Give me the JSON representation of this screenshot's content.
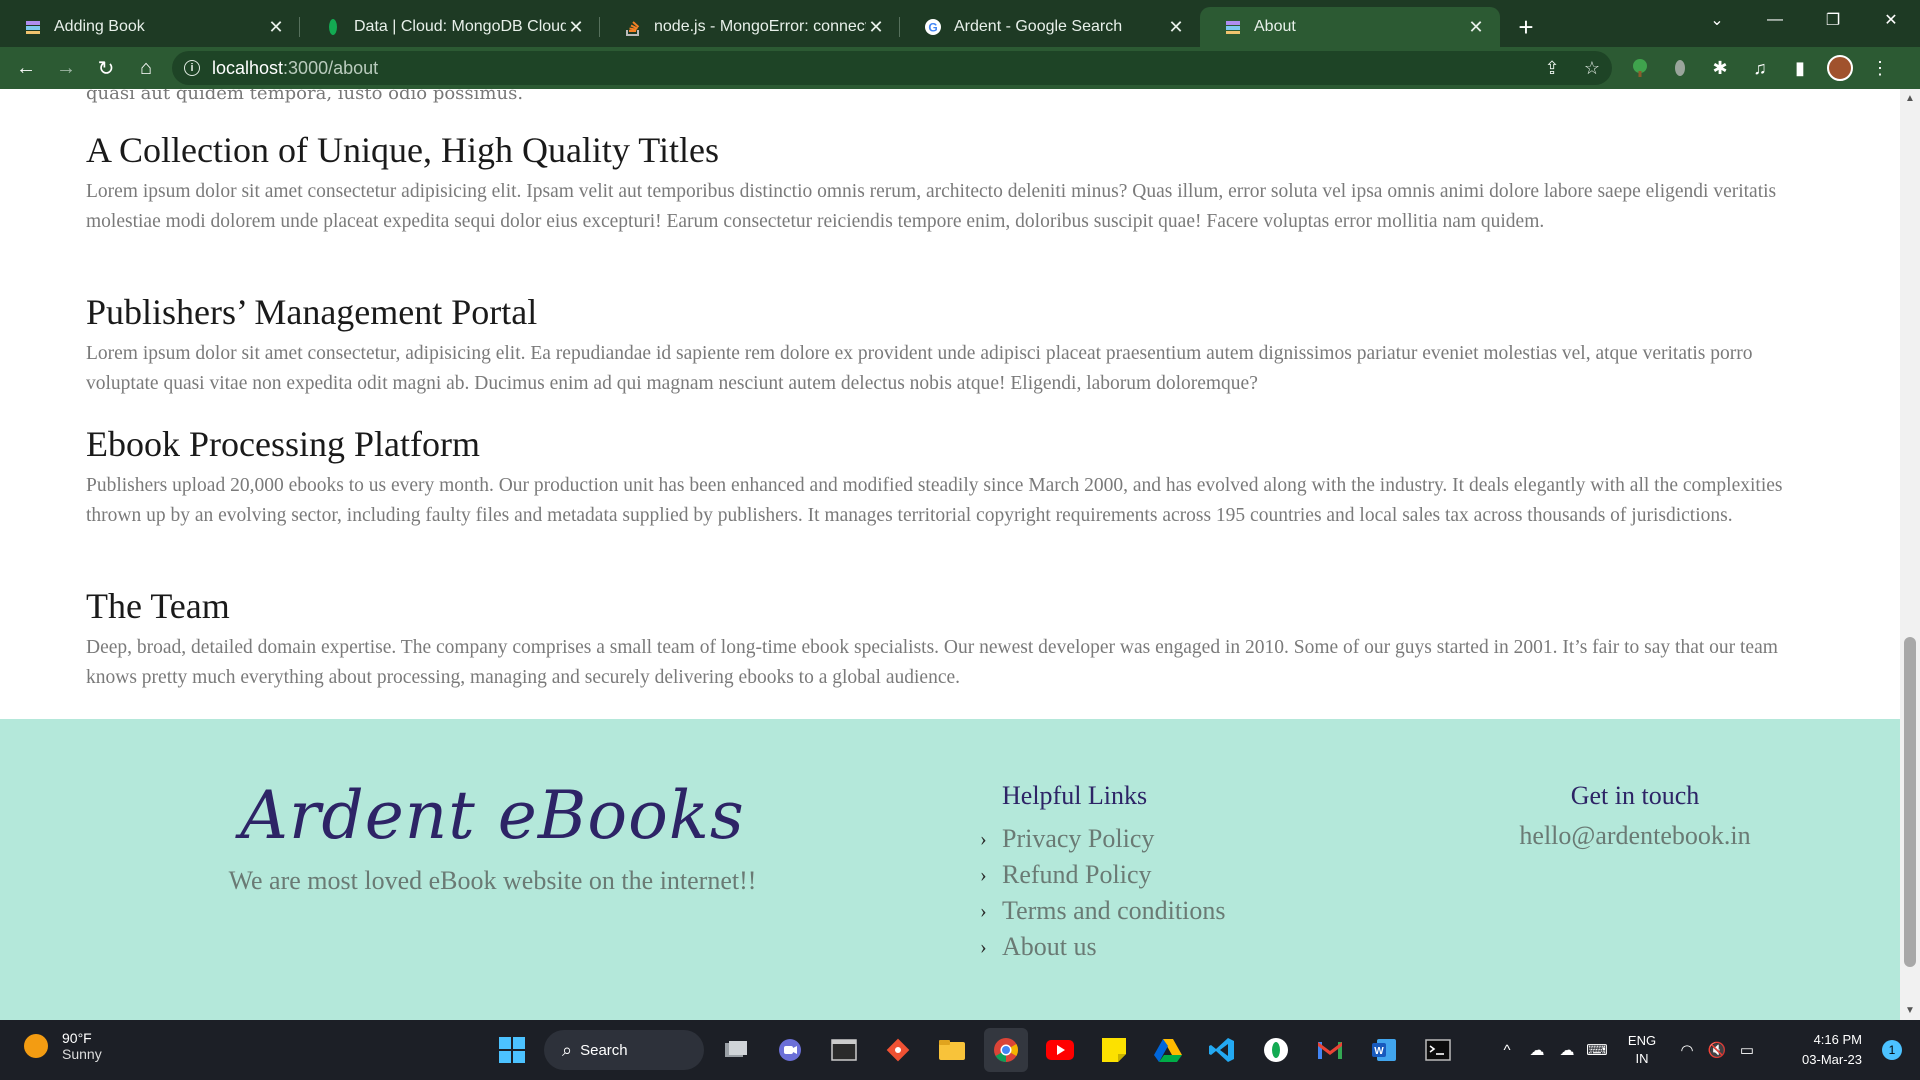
{
  "browser": {
    "tabs": [
      {
        "title": "Adding Book",
        "icon": "book-stack-icon",
        "active": false
      },
      {
        "title": "Data | Cloud: MongoDB Cloud",
        "icon": "mongodb-leaf-icon",
        "active": false
      },
      {
        "title": "node.js - MongoError: connect E",
        "icon": "stackoverflow-icon",
        "active": false
      },
      {
        "title": "Ardent - Google Search",
        "icon": "google-icon",
        "active": false
      },
      {
        "title": "About",
        "icon": "book-stack-icon",
        "active": true
      }
    ],
    "url_host": "localhost",
    "url_path": ":3000/about"
  },
  "page": {
    "cutoff_line": "quasi aut quidem tempora, iusto odio possimus.",
    "sections": [
      {
        "heading": "A Collection of Unique, High Quality Titles",
        "body": "Lorem ipsum dolor sit amet consectetur adipisicing elit. Ipsam velit aut temporibus distinctio omnis rerum, architecto deleniti minus? Quas illum, error soluta vel ipsa omnis animi dolore labore saepe eligendi veritatis molestiae modi dolorem unde placeat expedita sequi dolor eius excepturi! Earum consectetur reiciendis tempore enim, doloribus suscipit quae! Facere voluptas error mollitia nam quidem."
      },
      {
        "heading": "Publishers’ Management Portal",
        "body": "Lorem ipsum dolor sit amet consectetur, adipisicing elit. Ea repudiandae id sapiente rem dolore ex provident unde adipisci placeat praesentium autem dignissimos pariatur eveniet molestias vel, atque veritatis porro voluptate quasi vitae non expedita odit magni ab. Ducimus enim ad qui magnam nesciunt autem delectus nobis atque! Eligendi, laborum doloremque?"
      },
      {
        "heading": "Ebook Processing Platform",
        "body": "Publishers upload 20,000 ebooks to us every month. Our production unit has been enhanced and modified steadily since March 2000, and has evolved along with the industry. It deals elegantly with all the complexities thrown up by an evolving sector, including faulty files and metadata supplied by publishers. It manages territorial copyright requirements across 195 countries and local sales tax across thousands of jurisdictions."
      },
      {
        "heading": "The Team",
        "body": "Deep, broad, detailed domain expertise. The company comprises a small team of long-time ebook specialists. Our newest developer was engaged in 2010. Some of our guys started in 2001. It’s fair to say that our team knows pretty much everything about processing, managing and securely delivering ebooks to a global audience."
      }
    ]
  },
  "footer": {
    "brand": "Ardent eBooks",
    "tagline": "We are most loved eBook website on the internet!!",
    "links_heading": "Helpful Links",
    "links": [
      "Privacy Policy",
      "Refund Policy",
      "Terms and conditions",
      "About us"
    ],
    "contact_heading": "Get in touch",
    "email": "hello@ardentebook.in",
    "bg_color": "#b4e8da",
    "accent_color": "#2d2466"
  },
  "taskbar": {
    "temperature": "90°F",
    "condition": "Sunny",
    "search_label": "Search",
    "lang_1": "ENG",
    "lang_2": "IN",
    "time": "4:16 PM",
    "date": "03-Mar-23",
    "notification_count": "1"
  }
}
